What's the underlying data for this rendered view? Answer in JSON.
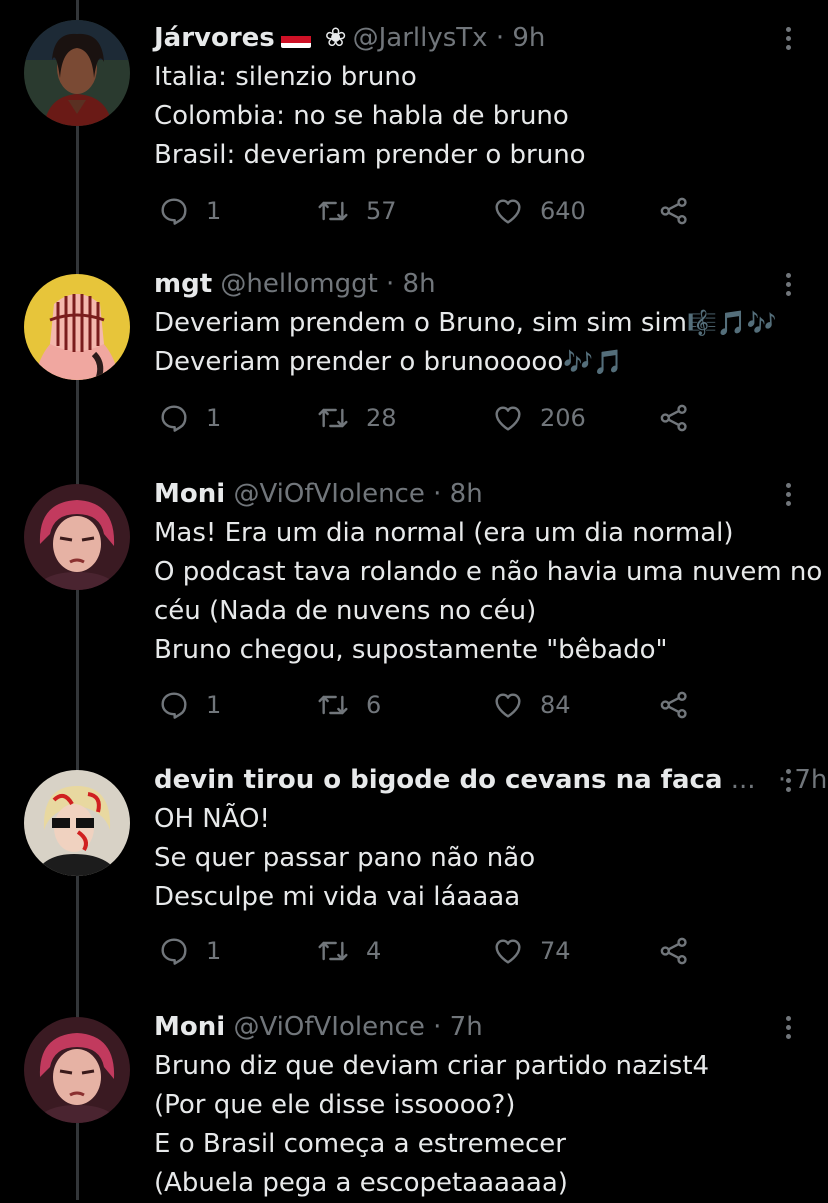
{
  "tweets": [
    {
      "display_name": "Járvores",
      "handle": "@JarllysTx",
      "time": "· 9h",
      "lines": [
        "Italia: silenzio bruno",
        "Colombia: no se habla de bruno",
        "Brasil: deveriam prender o bruno"
      ],
      "replies": "1",
      "retweets": "57",
      "likes": "640"
    },
    {
      "display_name": "mgt",
      "handle": "@hellomggt",
      "time": "· 8h",
      "lines": [
        "Deveriam prendem o Bruno, sim sim sim",
        "Deveriam prender o brunooooo"
      ],
      "emoji_line1": "🎼🎵🎶",
      "emoji_line2": "🎶🎵",
      "replies": "1",
      "retweets": "28",
      "likes": "206"
    },
    {
      "display_name": "Moni",
      "handle": "@ViOfVIolence",
      "time": "· 8h",
      "lines": [
        "Mas! Era um dia normal (era um dia normal)",
        "O podcast tava rolando e não havia uma nuvem no",
        "céu (Nada de nuvens no céu)",
        "Bruno chegou, supostamente \"bêbado\""
      ],
      "replies": "1",
      "retweets": "6",
      "likes": "84"
    },
    {
      "display_name": "devin tirou o bigode do cevans na faca",
      "ellipsis": "...",
      "time": "· 7h",
      "lines": [
        "OH NÃO!",
        "Se quer passar pano não não",
        "Desculpe mi vida vai láaaaa"
      ],
      "replies": "1",
      "retweets": "4",
      "likes": "74"
    },
    {
      "display_name": "Moni",
      "handle": "@ViOfVIolence",
      "time": "· 7h",
      "lines": [
        "Bruno diz que deviam criar partido nazist4",
        "(Por que ele disse issoooo?)",
        "E o Brasil começa a estremecer",
        "(Abuela pega a escopetaaaaaa)"
      ]
    }
  ],
  "icons": {
    "reply": "reply-icon",
    "retweet": "retweet-icon",
    "like": "heart-icon",
    "share": "share-icon",
    "more": "more-icon",
    "flag": "yemen-flag-icon",
    "flower": "flower-icon"
  },
  "colors": {
    "background": "#000000",
    "text": "#e7e9ea",
    "secondary": "#71767b",
    "thread_line": "#333639"
  }
}
